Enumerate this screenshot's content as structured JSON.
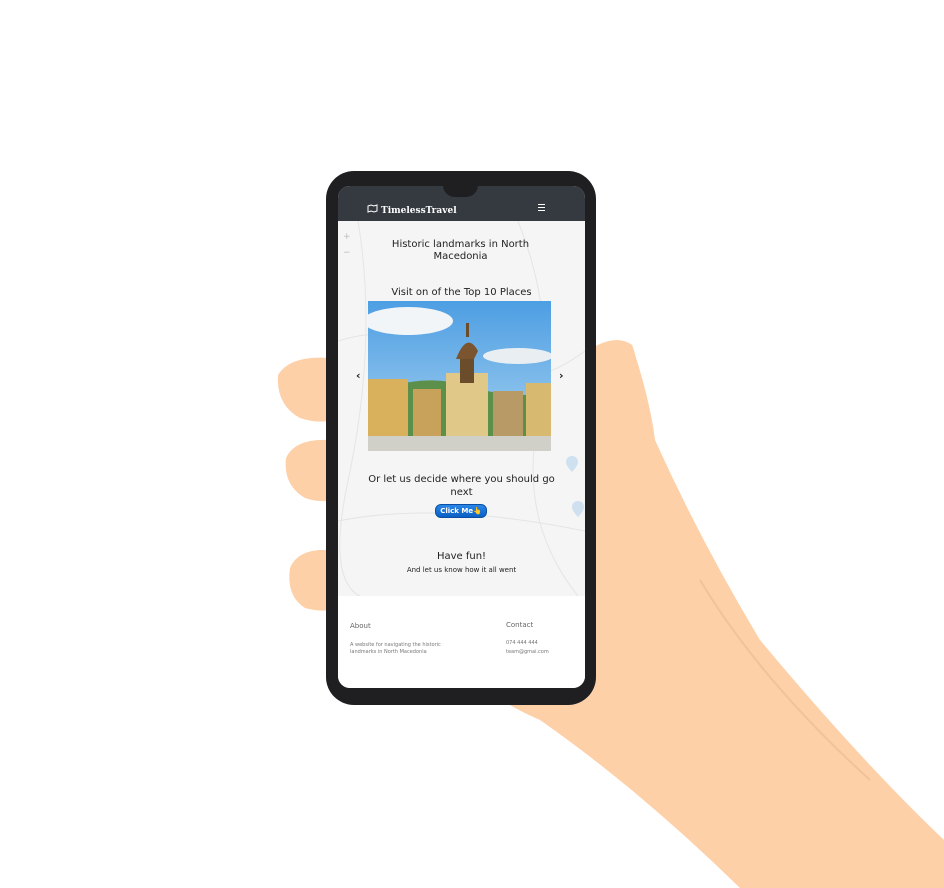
{
  "navbar": {
    "brand": "TimelessTravel",
    "brand_icon": "world-map-icon",
    "menu_icon": "hamburger-icon"
  },
  "map": {
    "zoom_in": "+",
    "zoom_out": "−"
  },
  "hero": {
    "title": "Historic landmarks in North Macedonia",
    "subtitle": "Visit on of the Top 10 Places"
  },
  "carousel": {
    "prev": "‹",
    "next": "›"
  },
  "random": {
    "heading": "Or let us decide where you should go next",
    "button_label": "Click Me👆"
  },
  "fun": {
    "heading": "Have fun!",
    "subheading": "And let us know how it all went"
  },
  "footer": {
    "about_title": "About",
    "about_text": "A website for  navigating the historic landmarks in North Macedonia",
    "contact_title": "Contact",
    "phone": "074 444 444",
    "email": "team@gmai.com"
  },
  "colors": {
    "navbar": "#343a40",
    "button": "#0d6efd",
    "skin": "#fcd4ae",
    "phone_body": "#1f1f21"
  }
}
